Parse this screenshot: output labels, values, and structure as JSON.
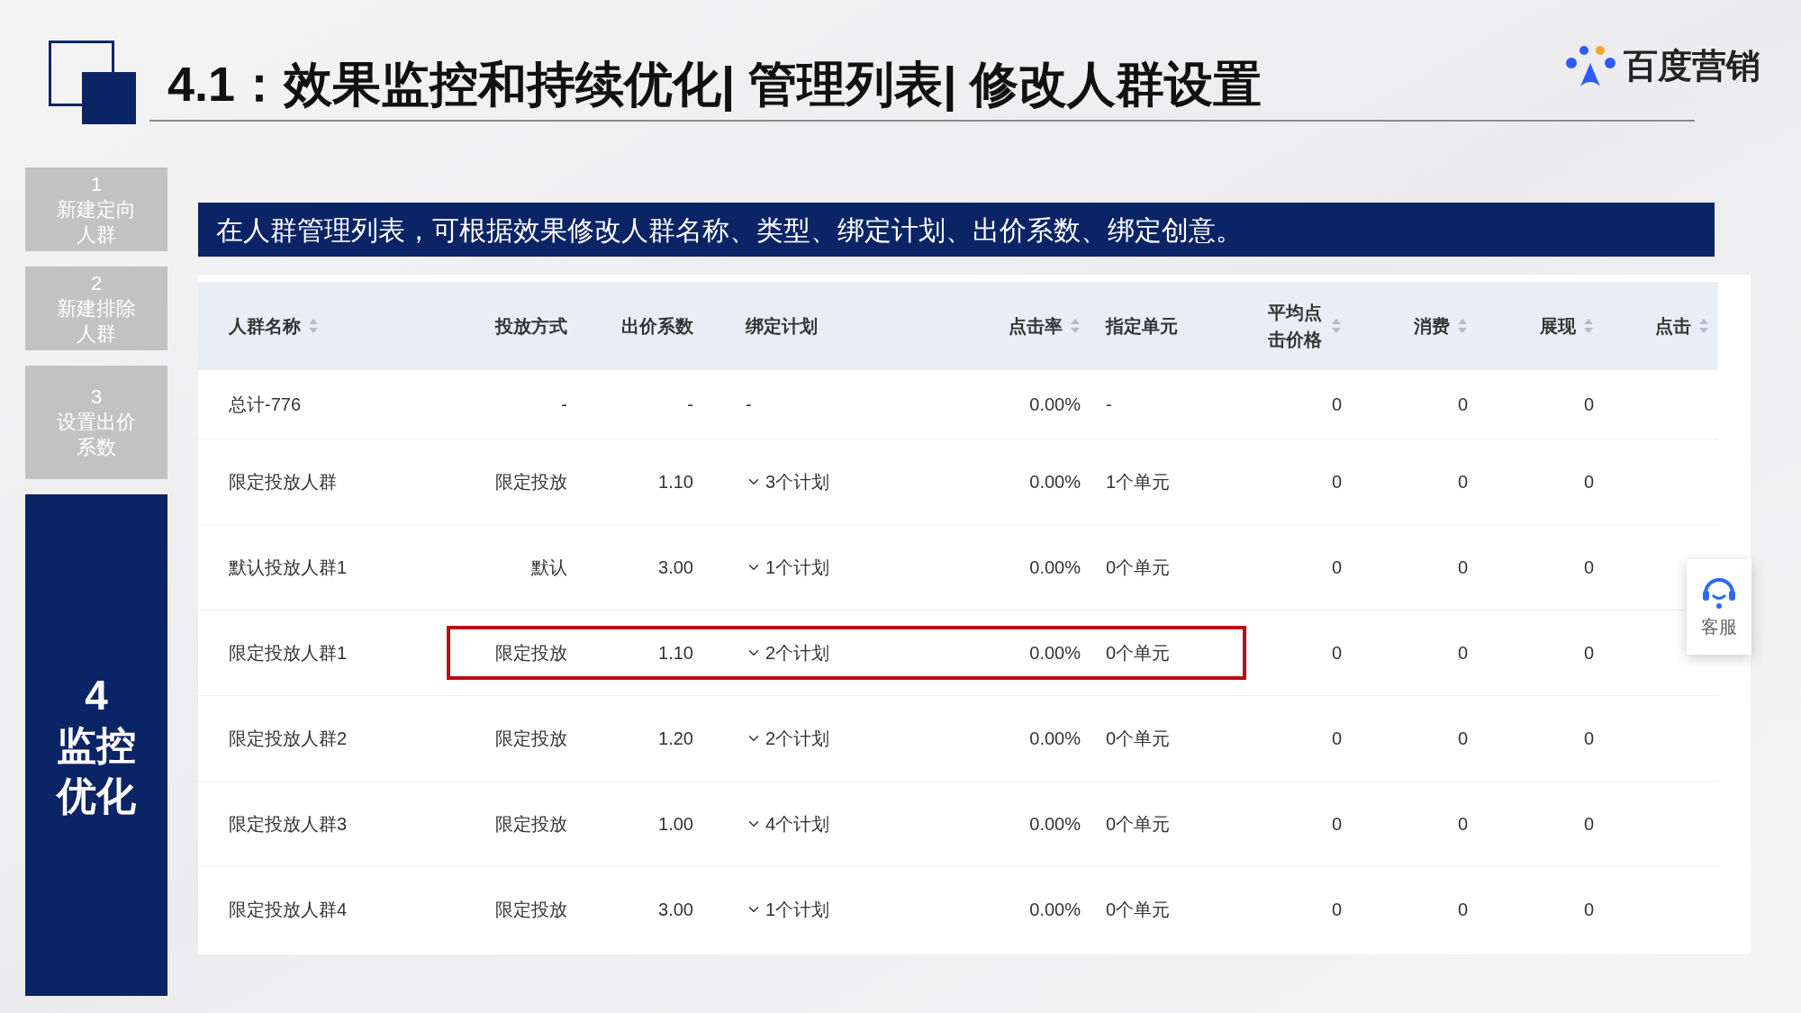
{
  "title": "4.1：效果监控和持续优化| 管理列表| 修改人群设置",
  "logo": {
    "text": "百度营销"
  },
  "steps": [
    {
      "number": "1",
      "label": "新建定向人群",
      "selected": false
    },
    {
      "number": "2",
      "label": "新建排除人群",
      "selected": false
    },
    {
      "number": "3",
      "label": "设置出价系数",
      "selected": false
    },
    {
      "number": "4",
      "label": "监控优化",
      "selected": true
    }
  ],
  "banner": "在人群管理列表，可根据效果修改人群名称、类型、绑定计划、出价系数、绑定创意。",
  "table": {
    "columns": [
      {
        "label": "人群名称",
        "sortable": true
      },
      {
        "label": "投放方式",
        "sortable": false
      },
      {
        "label": "出价系数",
        "sortable": false
      },
      {
        "label": "绑定计划",
        "sortable": false
      },
      {
        "label": "点击率",
        "sortable": true
      },
      {
        "label": "指定单元",
        "sortable": false
      },
      {
        "label": "平均点击价格",
        "sortable": true
      },
      {
        "label": "消费",
        "sortable": true
      },
      {
        "label": "展现",
        "sortable": true
      },
      {
        "label": "点击",
        "sortable": true
      }
    ],
    "rows": [
      {
        "kind": "total",
        "highlighted": false,
        "cells": [
          "总计-776",
          "-",
          "-",
          "-",
          "0.00%",
          "-",
          "0",
          "0",
          "0"
        ]
      },
      {
        "kind": "group",
        "highlighted": false,
        "cells": [
          "限定投放人群",
          "限定投放",
          "1.10",
          "3个计划",
          "0.00%",
          "1个单元",
          "0",
          "0",
          "0"
        ]
      },
      {
        "kind": "group",
        "highlighted": false,
        "cells": [
          "默认投放人群1",
          "默认",
          "3.00",
          "1个计划",
          "0.00%",
          "0个单元",
          "0",
          "0",
          "0"
        ]
      },
      {
        "kind": "group",
        "highlighted": true,
        "cells": [
          "限定投放人群1",
          "限定投放",
          "1.10",
          "2个计划",
          "0.00%",
          "0个单元",
          "0",
          "0",
          "0"
        ]
      },
      {
        "kind": "group",
        "highlighted": false,
        "cells": [
          "限定投放人群2",
          "限定投放",
          "1.20",
          "2个计划",
          "0.00%",
          "0个单元",
          "0",
          "0",
          "0"
        ]
      },
      {
        "kind": "group",
        "highlighted": false,
        "cells": [
          "限定投放人群3",
          "限定投放",
          "1.00",
          "4个计划",
          "0.00%",
          "0个单元",
          "0",
          "0",
          "0"
        ]
      },
      {
        "kind": "group",
        "highlighted": false,
        "cells": [
          "限定投放人群4",
          "限定投放",
          "3.00",
          "1个计划",
          "0.00%",
          "0个单元",
          "0",
          "0",
          "0"
        ]
      }
    ]
  },
  "service": {
    "label": "客服"
  }
}
